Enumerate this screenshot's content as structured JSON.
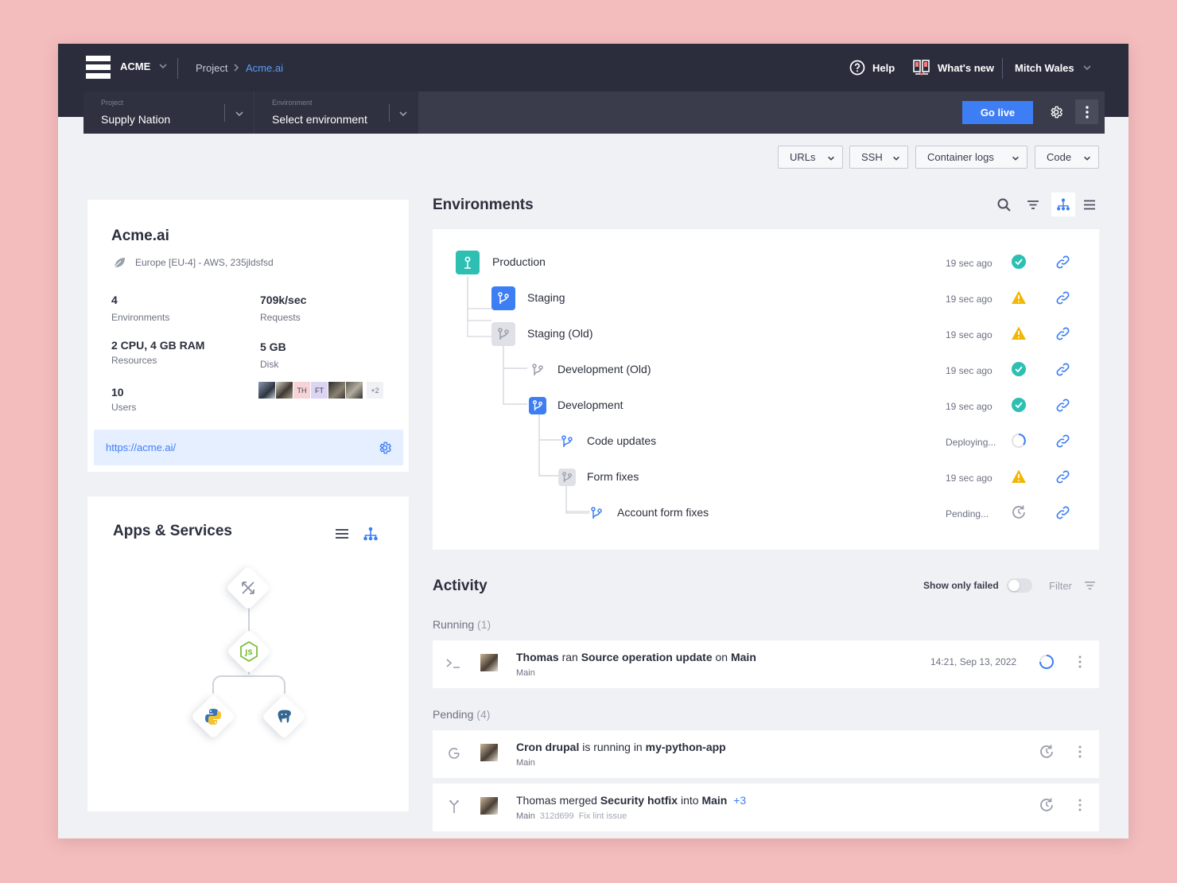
{
  "topbar": {
    "org": "ACME",
    "breadcrumb": [
      "Project",
      "Acme.ai"
    ],
    "help": "Help",
    "whats_new": "What's new",
    "user": "Mitch Wales"
  },
  "selectors": {
    "project_label": "Project",
    "project_value": "Supply Nation",
    "environment_label": "Environment",
    "environment_value": "Select environment",
    "go_live": "Go live"
  },
  "toolbar": [
    "URLs",
    "SSH",
    "Container logs",
    "Code"
  ],
  "project_card": {
    "title": "Acme.ai",
    "region": "Europe [EU-4] - AWS, 235jldsfsd",
    "stats": [
      {
        "value": "4",
        "label": "Environments"
      },
      {
        "value": "709k/sec",
        "label": "Requests"
      },
      {
        "value": "2 CPU, 4 GB RAM",
        "label": "Resources"
      },
      {
        "value": "5 GB",
        "label": "Disk"
      },
      {
        "value": "10",
        "label": "Users"
      }
    ],
    "avatars": [
      "TH",
      "FT"
    ],
    "avatars_more": "+2",
    "url": "https://acme.ai/"
  },
  "apps": {
    "title": "Apps & Services",
    "nodes": [
      "router-icon",
      "nodejs-icon",
      "python-icon",
      "postgresql-icon"
    ]
  },
  "environments": {
    "title": "Environments",
    "rows": [
      {
        "name": "Production",
        "time": "19 sec ago",
        "status": "success"
      },
      {
        "name": "Staging",
        "time": "19 sec ago",
        "status": "warning"
      },
      {
        "name": "Staging (Old)",
        "time": "19 sec ago",
        "status": "warning"
      },
      {
        "name": "Development (Old)",
        "time": "19 sec ago",
        "status": "success"
      },
      {
        "name": "Development",
        "time": "19 sec ago",
        "status": "success"
      },
      {
        "name": "Code updates",
        "time": "Deploying...",
        "status": "deploying"
      },
      {
        "name": "Form fixes",
        "time": "19 sec ago",
        "status": "warning"
      },
      {
        "name": "Account form fixes",
        "time": "Pending...",
        "status": "pending"
      }
    ]
  },
  "activity": {
    "title": "Activity",
    "show_failed": "Show only failed",
    "filter": "Filter",
    "running_label": "Running",
    "running_count": "(1)",
    "pending_label": "Pending",
    "pending_count": "(4)",
    "running": [
      {
        "actor": "Thomas",
        "verb1": " ran ",
        "object": "Source operation update",
        "verb2": " on ",
        "target": "Main",
        "branch": "Main",
        "time": "14:21, Sep 13, 2022"
      }
    ],
    "pending": [
      {
        "actor": "Cron drupal",
        "verb1": " is running in ",
        "object": "my-python-app",
        "branch": "Main"
      },
      {
        "actor": "Thomas",
        "verb1": " merged ",
        "object": "Security hotfix",
        "verb2": " into ",
        "target": "Main",
        "extra": "+3",
        "branch": "Main",
        "commit": "312d699",
        "message": "Fix lint issue"
      }
    ]
  },
  "colors": {
    "accent": "#3d7ef5",
    "success": "#2ebfb3",
    "warning": "#f2b705",
    "topbar": "#2b2d3d",
    "background": "#f3bcbd"
  }
}
